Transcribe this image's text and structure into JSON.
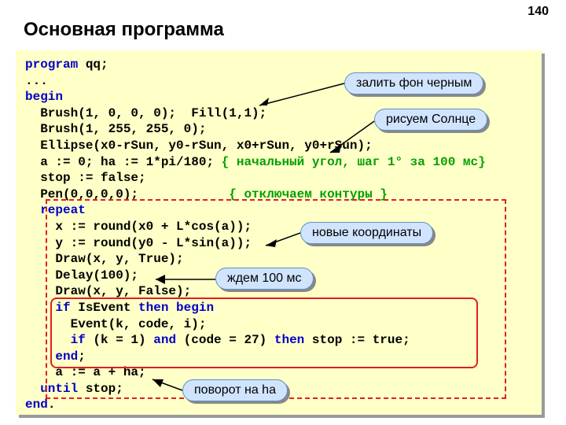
{
  "pageNumber": "140",
  "title": "Основная программа",
  "code": {
    "l1a": "program",
    "l1b": " qq;",
    "l2": "...",
    "l3": "begin",
    "l4": "  Brush(1, 0, 0, 0);  Fill(1,1);",
    "l5": "  Brush(1, 255, 255, 0);",
    "l6": "  Ellipse(x0-rSun, y0-rSun, x0+rSun, y0+rSun);",
    "l7a": "  a := 0; ha := 1*pi/180; ",
    "l7c": "{ начальный угол, шаг 1° за 100 мс}",
    "l8": "  stop := false;",
    "l9a": "  Pen(0,0,0,0);            ",
    "l9c": "{ отключаем контуры }",
    "l10a": "  ",
    "l10b": "repeat",
    "l11": "    x := round(x0 + L*cos(a));",
    "l12": "    y := round(y0 - L*sin(a));",
    "l13": "    Draw(x, y, True);",
    "l14": "    Delay(100);",
    "l15": "    Draw(x, y, False);",
    "l16a": "    ",
    "l16b": "if",
    "l16c": " IsEvent ",
    "l16d": "then begin",
    "l17": "      Event(k, code, i);",
    "l18a": "      ",
    "l18b": "if",
    "l18c": " (k = 1) ",
    "l18d": "and",
    "l18e": " (code = 27) ",
    "l18f": "then",
    "l18g": " stop := true;",
    "l19a": "    ",
    "l19b": "end",
    "l19c": ";",
    "l20": "    a := a + ha;",
    "l21a": "  ",
    "l21b": "until",
    "l21c": " stop;",
    "l22a": "end",
    "l22b": "."
  },
  "callouts": {
    "c1": "залить фон черным",
    "c2": "рисуем Солнце",
    "c3": "новые координаты",
    "c4": "ждем 100 мс",
    "c5": "поворот на ha"
  }
}
